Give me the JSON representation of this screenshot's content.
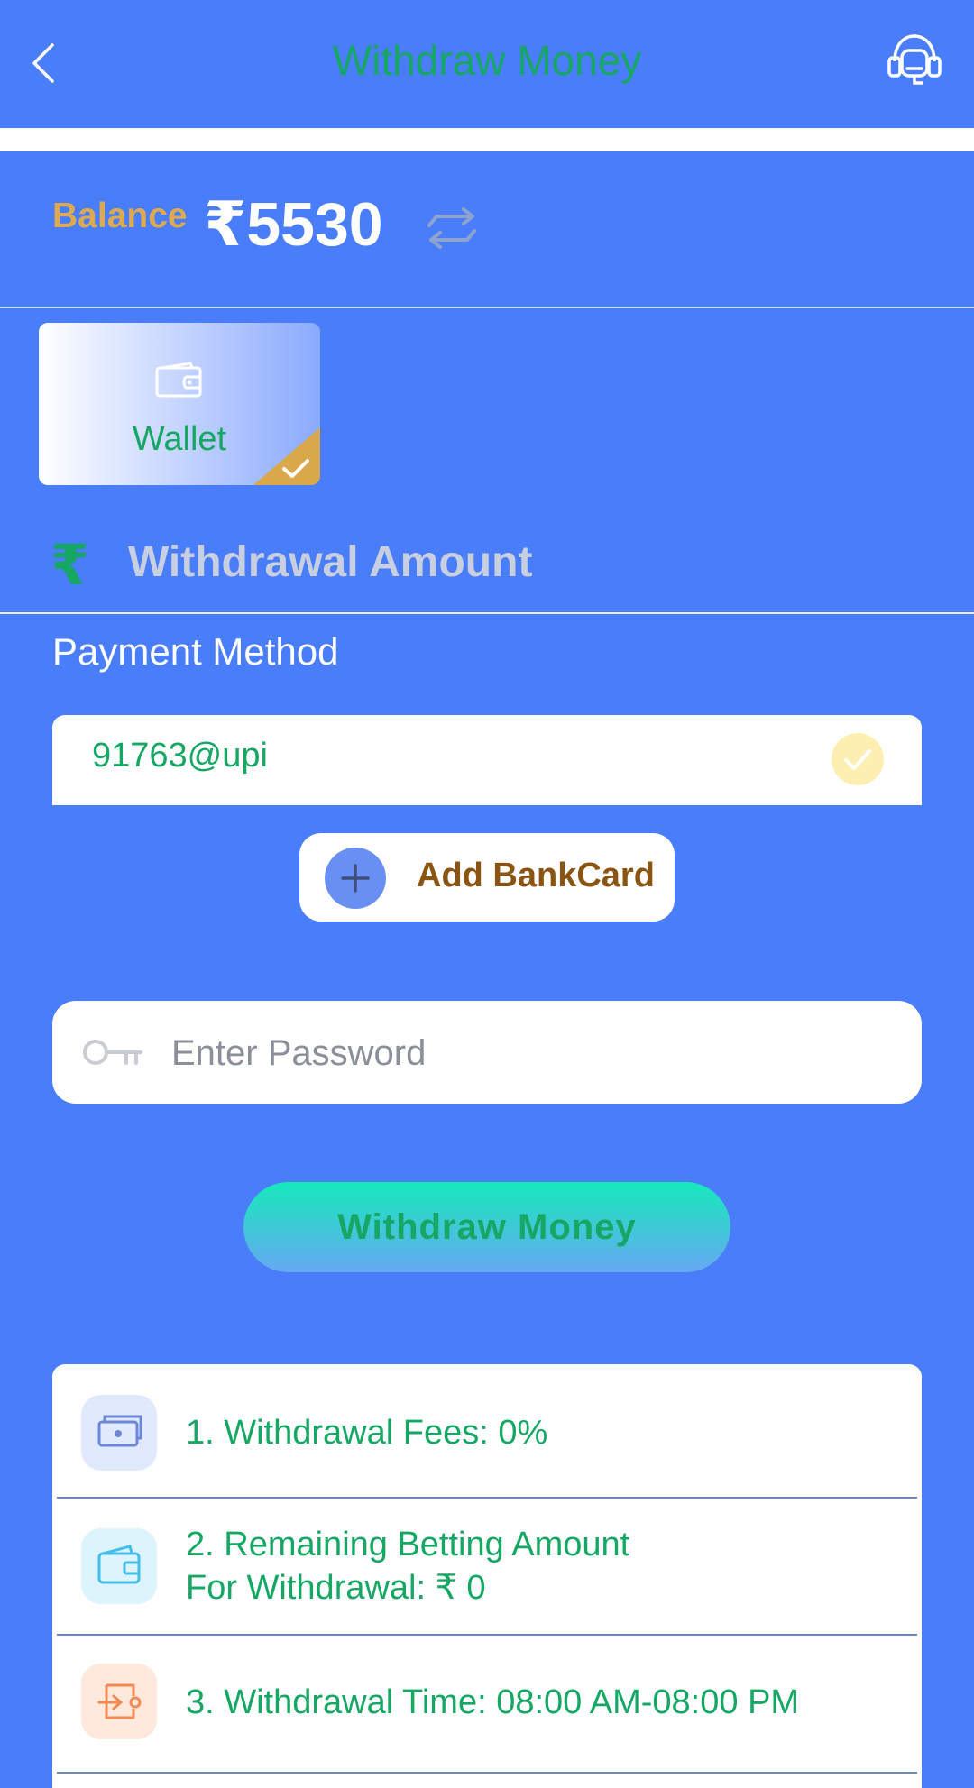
{
  "header": {
    "title": "Withdraw Money",
    "back": "back",
    "support": "customer-support"
  },
  "balance": {
    "label": "Balance",
    "value": "₹5530"
  },
  "wallet": {
    "label": "Wallet",
    "selected": true
  },
  "amount": {
    "currency_symbol": "₹",
    "placeholder": "Withdrawal Amount"
  },
  "payment": {
    "label": "Payment Method",
    "upi": "91763@upi"
  },
  "add_card": {
    "label": "Add BankCard"
  },
  "password": {
    "placeholder": "Enter Password"
  },
  "withdraw_button": {
    "label": "Withdraw Money"
  },
  "info": [
    {
      "line1": "1. Withdrawal Fees: 0%"
    },
    {
      "line1": "2. Remaining Betting Amount",
      "line2": "For Withdrawal: ₹ 0"
    },
    {
      "line1": "3. Withdrawal Time: 08:00 AM-08:00 PM"
    }
  ],
  "colors": {
    "primary": "#4a7df9",
    "text_green": "#16a765",
    "balance_gold": "#dcaa50",
    "add_card_brown": "#8a5412"
  }
}
